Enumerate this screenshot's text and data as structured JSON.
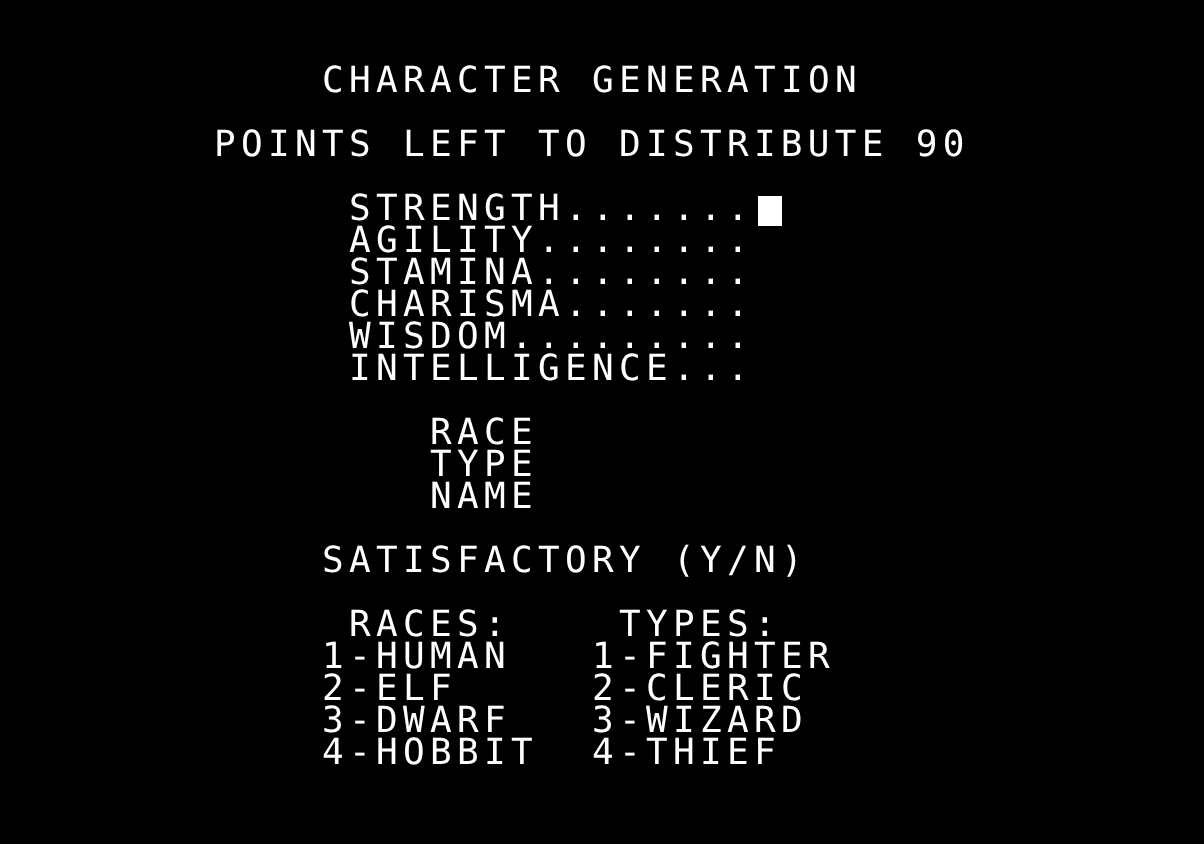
{
  "title": "CHARACTER GENERATION",
  "points_line": "POINTS LEFT TO DISTRIBUTE 90",
  "stats": [
    {
      "label": "STRENGTH.......",
      "cursor": true
    },
    {
      "label": "AGILITY........",
      "cursor": false
    },
    {
      "label": "STAMINA........",
      "cursor": false
    },
    {
      "label": "CHARISMA.......",
      "cursor": false
    },
    {
      "label": "WISDOM.........",
      "cursor": false
    },
    {
      "label": "INTELLIGENCE...",
      "cursor": false
    }
  ],
  "fields": [
    "RACE",
    "TYPE",
    "NAME"
  ],
  "prompt": "SATISFACTORY (Y/N)",
  "races": {
    "heading": "RACES:",
    "items": [
      "1-HUMAN",
      "2-ELF",
      "3-DWARF",
      "4-HOBBIT"
    ]
  },
  "types": {
    "heading": "TYPES:",
    "items": [
      "1-FIGHTER",
      "2-CLERIC",
      "3-WIZARD",
      "4-THIEF"
    ]
  }
}
